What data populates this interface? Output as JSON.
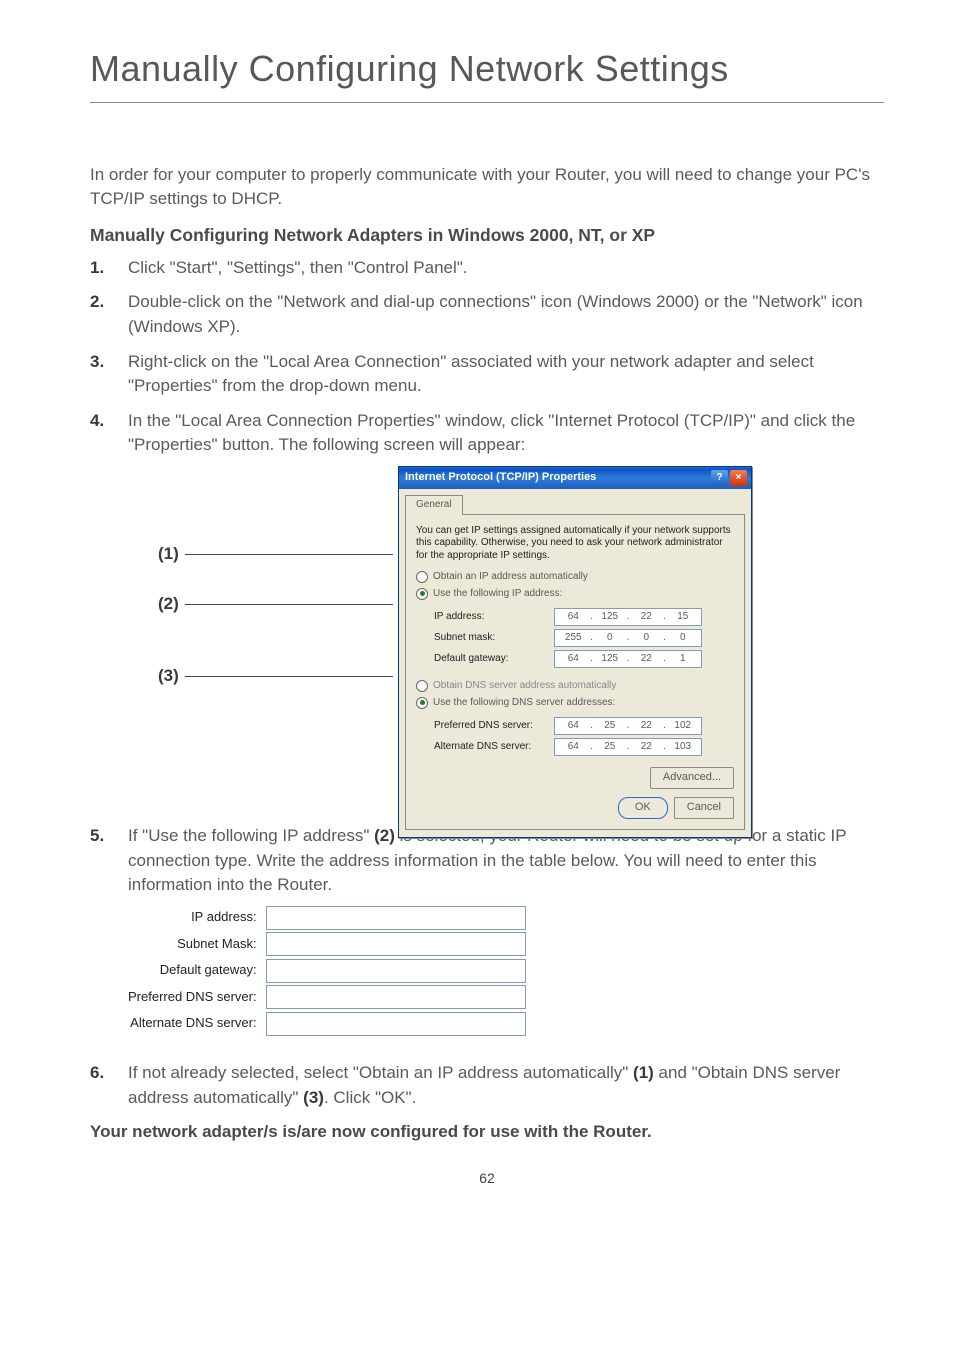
{
  "title": "Manually Configuring Network Settings",
  "intro": "In order for your computer to properly communicate with your Router, you will need to change your PC's TCP/IP settings to DHCP.",
  "subheading": "Manually Configuring Network Adapters in Windows 2000, NT, or XP",
  "steps": {
    "s1": "Click \"Start\", \"Settings\", then \"Control Panel\".",
    "s2": "Double-click on the \"Network and dial-up connections\" icon (Windows 2000) or the \"Network\" icon (Windows XP).",
    "s3": "Right-click on the \"Local Area Connection\" associated with your network adapter and select \"Properties\" from the drop-down menu.",
    "s4": "In the \"Local Area Connection Properties\" window, click \"Internet Protocol (TCP/IP)\" and click the \"Properties\" button. The following screen will appear:",
    "s5_pre": "If \"Use the following IP address\" ",
    "s5_bold": "(2)",
    "s5_post": " is selected, your Router will need to be set up for a static IP connection type. Write the address information in the table below. You will need to enter this information into the Router.",
    "s6_pre": "If not already selected, select \"Obtain an IP address automatically\" ",
    "s6_b1": "(1)",
    "s6_mid": " and \"Obtain DNS server address automatically\" ",
    "s6_b2": "(3)",
    "s6_post": ". Click \"OK\"."
  },
  "footer": "Your network adapter/s is/are now configured for use with the Router.",
  "pagenum": "62",
  "callouts": {
    "c1": "(1)",
    "c2": "(2)",
    "c3": "(3)"
  },
  "dialog": {
    "title": "Internet Protocol (TCP/IP) Properties",
    "help_glyph": "?",
    "close_glyph": "×",
    "tab": "General",
    "desc": "You can get IP settings assigned automatically if your network supports this capability. Otherwise, you need to ask your network administrator for the appropriate IP settings.",
    "r1": "Obtain an IP address automatically",
    "r2": "Use the following IP address:",
    "ip_label": "IP address:",
    "ip": [
      "64",
      "125",
      "22",
      "15"
    ],
    "subnet_label": "Subnet mask:",
    "subnet": [
      "255",
      "0",
      "0",
      "0"
    ],
    "gw_label": "Default gateway:",
    "gw": [
      "64",
      "125",
      "22",
      "1"
    ],
    "r3": "Obtain DNS server address automatically",
    "r4": "Use the following DNS server addresses:",
    "pdns_label": "Preferred DNS server:",
    "pdns": [
      "64",
      "25",
      "22",
      "102"
    ],
    "adns_label": "Alternate DNS server:",
    "adns": [
      "64",
      "25",
      "22",
      "103"
    ],
    "advanced": "Advanced...",
    "ok": "OK",
    "cancel": "Cancel"
  },
  "form": {
    "ip": "IP address:",
    "subnet": "Subnet Mask:",
    "gw": "Default gateway:",
    "pdns": "Preferred DNS server:",
    "adns": "Alternate DNS server:"
  }
}
